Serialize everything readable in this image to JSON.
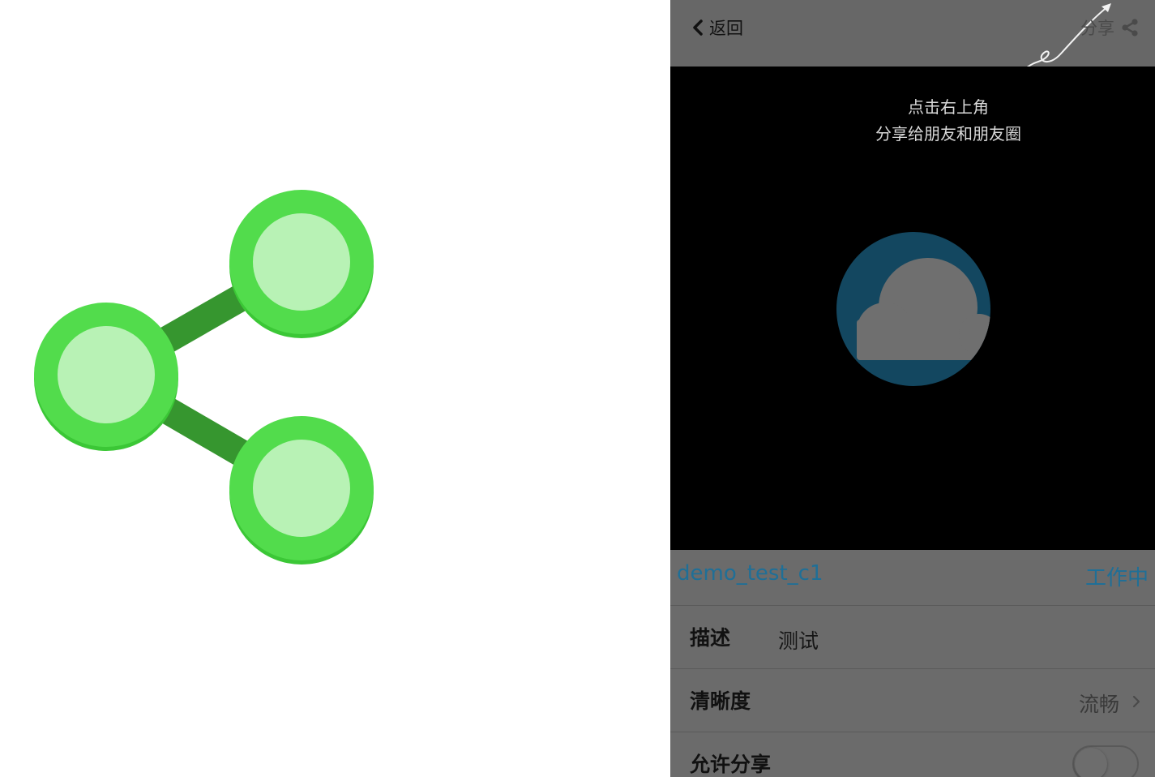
{
  "hero": {
    "icon": "share-icon"
  },
  "navbar": {
    "back_label": "返回",
    "share_label": "分享"
  },
  "video": {
    "hint_line1": "点击右上角",
    "hint_line2": "分享给朋友和朋友圈",
    "logo": "cloud-logo-icon"
  },
  "device": {
    "name": "demo_test_c1",
    "status": "工作中"
  },
  "settings": {
    "description": {
      "label": "描述",
      "value": "测试"
    },
    "resolution": {
      "label": "清晰度",
      "value": "流畅"
    },
    "allow_share": {
      "label": "允许分享",
      "enabled": false
    }
  },
  "colors": {
    "share_green": "#46d842",
    "share_light": "#b8f2b5",
    "share_line": "#36962f",
    "accent_blue": "#1f6f97"
  }
}
